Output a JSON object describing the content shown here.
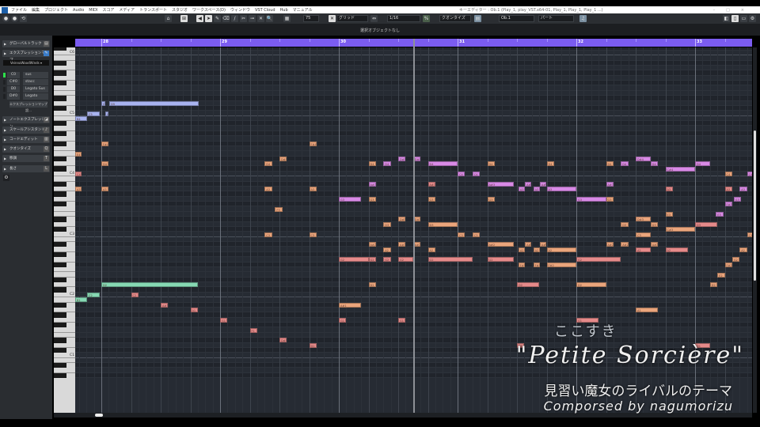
{
  "menu": {
    "items": [
      "ファイル",
      "編集",
      "プロジェクト",
      "Audio",
      "MIDI",
      "スコア",
      "メディア",
      "トランスポート",
      "スタジオ",
      "ワークスペース(D)",
      "ウィンドウ",
      "VST Cloud",
      "Hub",
      "マニュアル"
    ],
    "window_title": "キーエディター : Ob.1 (Play_1, play_VST.x64-01, Play_1, Play_1, Play_1 ...)"
  },
  "toolbar": {
    "velocity": "75",
    "grid_type": "グリッド",
    "quantize_value": "1/16",
    "quantize_label": "クオンタイズ",
    "track": "Ob.1",
    "part": "パート"
  },
  "infobar": {
    "text": "選択オブジェクトなし"
  },
  "left_panel": {
    "global_track": "グローバルトラック",
    "expression_map": "エクスプレッションマップ",
    "map_name": "VeinnaWoodWinds",
    "articulations": [
      {
        "key": "C0",
        "name": "sus",
        "active": true
      },
      {
        "key": "C#0",
        "name": "stacc",
        "active": false
      },
      {
        "key": "D0",
        "name": "Legato Sus",
        "active": false
      },
      {
        "key": "D#0",
        "name": "Legato",
        "active": false
      }
    ],
    "map_settings": "エクスプレッションマップ設...",
    "sections": [
      "ノートエクスプレッション",
      "スケールアシスタント",
      "コードエディット",
      "クオンタイズ",
      "移調",
      "長さ"
    ]
  },
  "ruler": {
    "bars": [
      "28",
      "29",
      "30",
      "31",
      "32",
      "33"
    ]
  },
  "piano": {
    "labels": [
      "C6",
      "C5",
      "C4",
      "C3",
      "C2",
      "C1"
    ]
  },
  "colors": {
    "o": "#eaa57c",
    "r": "#e58a8a",
    "p": "#d88ae6",
    "b": "#a8b3ef",
    "g": "#86d8b3"
  },
  "notes_format": [
    "name",
    "midi",
    "start_beat_from_bar28",
    "length_beats",
    "color"
  ],
  "notes": [
    [
      "D5",
      74,
      0,
      0.13,
      "b"
    ],
    [
      "D5",
      74,
      0.27,
      3,
      "b"
    ],
    [
      "C5",
      72,
      -0.48,
      0.43,
      "b"
    ],
    [
      "C5",
      72,
      0.13,
      0.12,
      "b"
    ],
    [
      "B4",
      71,
      -0.88,
      0.4,
      "b"
    ],
    [
      "D2",
      38,
      0,
      3.25,
      "g"
    ],
    [
      "C2",
      36,
      -0.48,
      0.43,
      "g"
    ],
    [
      "B1",
      35,
      -0.88,
      0.4,
      "g"
    ],
    [
      "C2",
      36,
      1,
      0.25,
      "r"
    ],
    [
      "A#1",
      34,
      2,
      0.25,
      "r"
    ],
    [
      "A1",
      33,
      3,
      0.25,
      "r"
    ],
    [
      "G1",
      31,
      4,
      0.25,
      "r"
    ],
    [
      "F1",
      29,
      5,
      0.25,
      "r"
    ],
    [
      "D#1",
      27,
      6,
      0.25,
      "r"
    ],
    [
      "D1",
      26,
      7,
      0.25,
      "r"
    ],
    [
      "F#4",
      66,
      0,
      0.25,
      "o"
    ],
    [
      "F#4",
      66,
      7,
      0.25,
      "o"
    ],
    [
      "E4",
      64,
      -0.88,
      0.2,
      "o"
    ],
    [
      "D#4",
      63,
      6,
      0.25,
      "o"
    ],
    [
      "D4",
      62,
      0,
      0.25,
      "o"
    ],
    [
      "D4",
      62,
      5.5,
      0.25,
      "o"
    ],
    [
      "D4",
      62,
      9,
      0.25,
      "o"
    ],
    [
      "D4",
      62,
      9.5,
      0.25,
      "p"
    ],
    [
      "D#4",
      63,
      10,
      0.25,
      "p"
    ],
    [
      "D#4",
      63,
      10.5,
      0.25,
      "p"
    ],
    [
      "D4",
      62,
      11,
      1,
      "p"
    ],
    [
      "D4",
      62,
      13,
      0.25,
      "o"
    ],
    [
      "D4",
      62,
      15,
      0.25,
      "o"
    ],
    [
      "D4",
      62,
      17,
      0.25,
      "o"
    ],
    [
      "D4",
      62,
      17.5,
      0.25,
      "p"
    ],
    [
      "D#4",
      63,
      18,
      0.5,
      "p"
    ],
    [
      "D4",
      62,
      18.5,
      0.25,
      "p"
    ],
    [
      "D4",
      62,
      20,
      0.5,
      "p"
    ],
    [
      "C#4",
      61,
      19,
      1,
      "p"
    ],
    [
      "C4",
      60,
      -0.88,
      0.2,
      "r"
    ],
    [
      "C4",
      60,
      12,
      0.25,
      "p"
    ],
    [
      "C4",
      60,
      12.5,
      0.25,
      "p"
    ],
    [
      "C4",
      60,
      21,
      0.25,
      "o"
    ],
    [
      "C4",
      60,
      21.75,
      0.2,
      "p"
    ],
    [
      "A#3",
      58,
      9,
      0.25,
      "p"
    ],
    [
      "A#3",
      58,
      11,
      0.25,
      "r"
    ],
    [
      "A#3",
      58,
      13,
      0.9,
      "p"
    ],
    [
      "A3",
      57,
      14.05,
      0.22,
      "p"
    ],
    [
      "A#3",
      58,
      14.27,
      0.22,
      "p"
    ],
    [
      "A3",
      57,
      14.55,
      0.22,
      "p"
    ],
    [
      "A#3",
      58,
      14.77,
      0.22,
      "p"
    ],
    [
      "A3",
      57,
      15,
      1,
      "p"
    ],
    [
      "A#3",
      58,
      17,
      0.25,
      "p"
    ],
    [
      "A3",
      57,
      19,
      0.25,
      "r"
    ],
    [
      "A3",
      57,
      21,
      0.25,
      "r"
    ],
    [
      "A3",
      57,
      21.5,
      0.25,
      "p"
    ],
    [
      "A3",
      57,
      -0.88,
      0.2,
      "o"
    ],
    [
      "A3",
      57,
      0,
      0.25,
      "o"
    ],
    [
      "A3",
      57,
      5.5,
      0.25,
      "o"
    ],
    [
      "A3",
      57,
      7,
      0.25,
      "o"
    ],
    [
      "G3",
      55,
      8,
      0.75,
      "p"
    ],
    [
      "G3",
      55,
      9,
      0.25,
      "o"
    ],
    [
      "G3",
      55,
      11,
      0.25,
      "o"
    ],
    [
      "G3",
      55,
      13,
      0.25,
      "o"
    ],
    [
      "G3",
      55,
      16,
      1,
      "p"
    ],
    [
      "G3",
      55,
      17,
      0.25,
      "o"
    ],
    [
      "G3",
      55,
      21.3,
      0.25,
      "p"
    ],
    [
      "F#3",
      54,
      21,
      0.25,
      "p"
    ],
    [
      "F3",
      53,
      5.85,
      0.25,
      "o"
    ],
    [
      "E3",
      52,
      19,
      0.25,
      "o"
    ],
    [
      "E3",
      52,
      20.7,
      0.25,
      "p"
    ],
    [
      "D#3",
      51,
      10,
      0.25,
      "o"
    ],
    [
      "D#3",
      51,
      10.5,
      0.25,
      "o"
    ],
    [
      "D#3",
      51,
      18,
      0.5,
      "o"
    ],
    [
      "D3",
      50,
      9.5,
      0.25,
      "o"
    ],
    [
      "D3",
      50,
      11,
      1,
      "o"
    ],
    [
      "D3",
      50,
      17.5,
      0.25,
      "o"
    ],
    [
      "D3",
      50,
      18.5,
      0.25,
      "o"
    ],
    [
      "D3",
      50,
      20,
      0.75,
      "r"
    ],
    [
      "C#3",
      49,
      19,
      1,
      "o"
    ],
    [
      "C3",
      48,
      5.5,
      0.25,
      "o"
    ],
    [
      "C3",
      48,
      7,
      0.25,
      "o"
    ],
    [
      "C3",
      48,
      12,
      0.25,
      "o"
    ],
    [
      "C3",
      48,
      12.5,
      0.25,
      "o"
    ],
    [
      "C3",
      48,
      18,
      0.5,
      "o"
    ],
    [
      "C3",
      48,
      21.75,
      0.2,
      "o"
    ],
    [
      "A#2",
      46,
      9,
      0.25,
      "o"
    ],
    [
      "A#2",
      46,
      10,
      0.25,
      "o"
    ],
    [
      "A#2",
      46,
      10.5,
      0.25,
      "o"
    ],
    [
      "A#2",
      46,
      13,
      0.9,
      "o"
    ],
    [
      "A#2",
      46,
      14.27,
      0.22,
      "o"
    ],
    [
      "A#2",
      46,
      14.77,
      0.22,
      "o"
    ],
    [
      "A#2",
      46,
      17,
      0.25,
      "o"
    ],
    [
      "A#2",
      46,
      17.5,
      0.25,
      "o"
    ],
    [
      "A#2",
      46,
      18.5,
      0.25,
      "o"
    ],
    [
      "A2",
      45,
      9.5,
      0.25,
      "o"
    ],
    [
      "A2",
      45,
      11,
      0.25,
      "o"
    ],
    [
      "A2",
      45,
      14.05,
      0.22,
      "o"
    ],
    [
      "A2",
      45,
      14.55,
      0.22,
      "o"
    ],
    [
      "A2",
      45,
      15,
      1,
      "o"
    ],
    [
      "A2",
      45,
      18,
      0.5,
      "r"
    ],
    [
      "A2",
      45,
      19,
      0.75,
      "r"
    ],
    [
      "A2",
      45,
      21.5,
      0.25,
      "o"
    ],
    [
      "G2",
      43,
      8,
      1,
      "r"
    ],
    [
      "G2",
      43,
      9,
      0.25,
      "r"
    ],
    [
      "G2",
      43,
      9.5,
      0.25,
      "r"
    ],
    [
      "G2",
      43,
      10,
      0.5,
      "r"
    ],
    [
      "G2",
      43,
      11,
      1.5,
      "r"
    ],
    [
      "G2",
      43,
      13,
      0.9,
      "r"
    ],
    [
      "G2",
      43,
      16,
      1.5,
      "r"
    ],
    [
      "G2",
      43,
      21.25,
      0.25,
      "o"
    ],
    [
      "F#2",
      42,
      14.05,
      0.22,
      "o"
    ],
    [
      "F#2",
      42,
      14.55,
      0.22,
      "o"
    ],
    [
      "F#2",
      42,
      15,
      1,
      "o"
    ],
    [
      "F#2",
      42,
      21,
      0.25,
      "o"
    ],
    [
      "E2",
      40,
      20.75,
      0.25,
      "o"
    ],
    [
      "D2",
      38,
      9,
      0.25,
      "o"
    ],
    [
      "D2",
      38,
      14,
      0.75,
      "r"
    ],
    [
      "D2",
      38,
      16,
      1,
      "o"
    ],
    [
      "D2",
      38,
      20.5,
      0.25,
      "o"
    ],
    [
      "A#1",
      34,
      8,
      0.75,
      "o"
    ],
    [
      "A1",
      33,
      18,
      0.75,
      "o"
    ],
    [
      "G1",
      31,
      8,
      0.25,
      "r"
    ],
    [
      "G1",
      31,
      10,
      0.25,
      "r"
    ],
    [
      "G1",
      31,
      16,
      0.75,
      "r"
    ],
    [
      "D1",
      26,
      14,
      0.25,
      "r"
    ],
    [
      "D1",
      26,
      20,
      0.5,
      "r"
    ]
  ],
  "overlay": {
    "comment": "ここすき",
    "title": "\"Petite Sorcière\"",
    "subtitle": "見習い魔女のライバルのテーマ",
    "credit": "Comporsed by nagumorizu"
  }
}
